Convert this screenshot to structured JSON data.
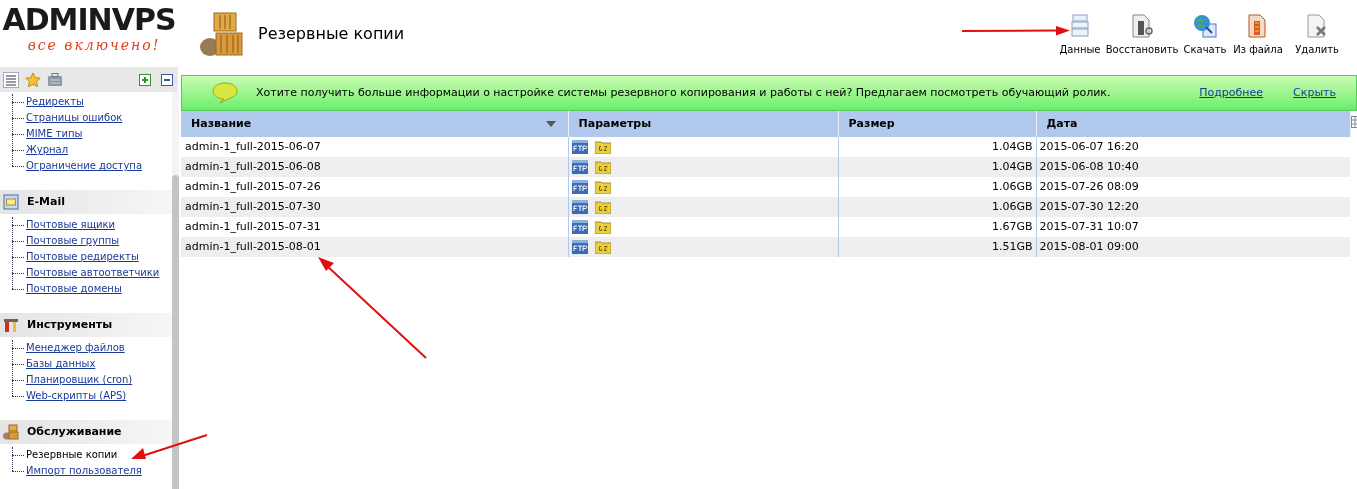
{
  "logo": {
    "name": "ADMINVPS",
    "tagline": "все включено!"
  },
  "page_title": "Резервные копии",
  "toolbar": [
    {
      "label": "Данные"
    },
    {
      "label": "Восстановить"
    },
    {
      "label": "Скачать"
    },
    {
      "label": "Из файла"
    },
    {
      "label": "Удалить"
    }
  ],
  "sidebar": {
    "groups": [
      {
        "items": [
          {
            "label": "Редиректы",
            "selected": false
          },
          {
            "label": "Страницы ошибок",
            "selected": false
          },
          {
            "label": "MIME типы",
            "selected": false
          },
          {
            "label": "Журнал",
            "selected": false
          },
          {
            "label": "Ограничение доступа",
            "selected": false
          }
        ]
      },
      {
        "title": "E-Mail",
        "items": [
          {
            "label": "Почтовые ящики",
            "selected": false
          },
          {
            "label": "Почтовые группы",
            "selected": false
          },
          {
            "label": "Почтовые редиректы",
            "selected": false
          },
          {
            "label": "Почтовые автоответчики",
            "selected": false
          },
          {
            "label": "Почтовые домены",
            "selected": false
          }
        ]
      },
      {
        "title": "Инструменты",
        "items": [
          {
            "label": "Менеджер файлов",
            "selected": false
          },
          {
            "label": "Базы данных",
            "selected": false
          },
          {
            "label": "Планировщик (cron)",
            "selected": false
          },
          {
            "label": "Web-скрипты (APS)",
            "selected": false
          }
        ]
      },
      {
        "title": "Обслуживание",
        "items": [
          {
            "label": "Резервные копии",
            "selected": true
          },
          {
            "label": "Импорт пользователя",
            "selected": false
          }
        ]
      }
    ]
  },
  "banner": {
    "text": "Хотите получить больше информации о настройке системы резервного копирования и работы с ней? Предлагаем посмотреть обучающий ролик.",
    "links": [
      "Подробнее",
      "Скрыть"
    ]
  },
  "table": {
    "columns": [
      "Название",
      "Параметры",
      "Размер",
      "Дата"
    ],
    "rows": [
      {
        "name": "admin-1_full-2015-06-07",
        "size": "1.04GB",
        "date": "2015-06-07 16:20"
      },
      {
        "name": "admin-1_full-2015-06-08",
        "size": "1.04GB",
        "date": "2015-06-08 10:40"
      },
      {
        "name": "admin-1_full-2015-07-26",
        "size": "1.06GB",
        "date": "2015-07-26 08:09"
      },
      {
        "name": "admin-1_full-2015-07-30",
        "size": "1.06GB",
        "date": "2015-07-30 12:20"
      },
      {
        "name": "admin-1_full-2015-07-31",
        "size": "1.67GB",
        "date": "2015-07-31 10:07"
      },
      {
        "name": "admin-1_full-2015-08-01",
        "size": "1.51GB",
        "date": "2015-08-01 09:00"
      }
    ]
  }
}
